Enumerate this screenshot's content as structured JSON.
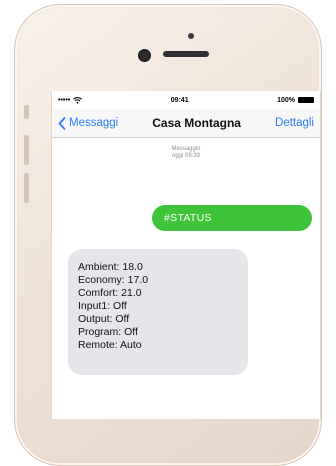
{
  "status_bar": {
    "carrier_dots": "•••••",
    "wifi_icon": "wifi-icon",
    "time": "09:41",
    "battery": "100%"
  },
  "nav": {
    "back_label": "Messaggi",
    "title": "Casa Montagna",
    "details_label": "Dettagli"
  },
  "conversation": {
    "meta_label": "Messaggio",
    "meta_time": "oggi 09:39",
    "outgoing_text": "#STATUS",
    "incoming_lines": [
      "Ambient: 18.0",
      "Economy: 17.0",
      "Comfort: 21.0",
      "Input1: Off",
      "Output: Off",
      "Program: Off",
      "Remote: Auto"
    ]
  },
  "colors": {
    "accent": "#2b7cf6",
    "outgoing_bubble": "#3fc33b",
    "incoming_bubble": "#e5e5ea",
    "phone_body": "#efe3d8"
  }
}
